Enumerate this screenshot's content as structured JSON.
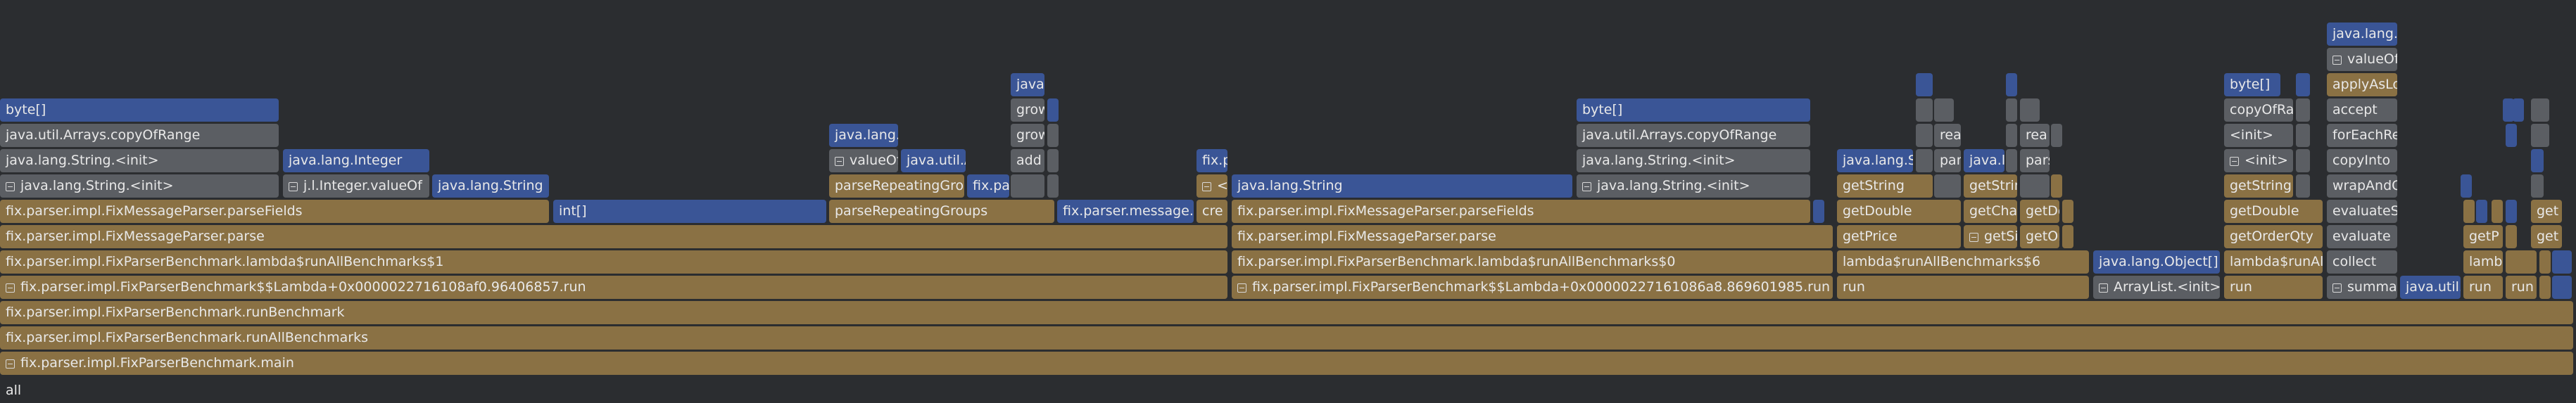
{
  "root_label": "all",
  "frames": {
    "main": "fix.parser.impl.FixParserBenchmark.main",
    "runAll": "fix.parser.impl.FixParserBenchmark.runAllBenchmarks",
    "runBench": "fix.parser.impl.FixParserBenchmark.runBenchmark",
    "lambdaL": "fix.parser.impl.FixParserBenchmark$$Lambda+0x0000022716108af0.96406857.run",
    "lambdaM": "fix.parser.impl.FixParserBenchmark$$Lambda+0x00000227161086a8.869601985.run",
    "run": "run",
    "arrayListInit": "ArrayList.<init>",
    "summar": "summar",
    "javaUtil": "java.util.",
    "runAbbrev": "run",
    "runAbbrev2": "run",
    "lambda1": "fix.parser.impl.FixParserBenchmark.lambda$runAllBenchmarks$1",
    "lambda0": "fix.parser.impl.FixParserBenchmark.lambda$runAllBenchmarks$0",
    "lambda6": "lambda$runAllBenchmarks$6",
    "objArr": "java.lang.Object[]",
    "lambdaRunAll": "lambda$runAll",
    "collect": "collect",
    "lamb": "lamb",
    "parseL": "fix.parser.impl.FixMessageParser.parse",
    "parseM": "fix.parser.impl.FixMessageParser.parse",
    "getPrice": "getPrice",
    "getSi": "getSi",
    "getOr": "getOr",
    "getOrderQty": "getOrderQty",
    "evaluate": "evaluate",
    "getPAbbrev": "getP",
    "getAbbrev": "get",
    "parseFieldsL": "fix.parser.impl.FixMessageParser.parseFields",
    "intArr": "int[]",
    "parseRepeatingGroups": "parseRepeatingGroups",
    "fixParserMessageB": "fix.parser.message.b",
    "cre": "cre",
    "parseFieldsM": "fix.parser.impl.FixMessageParser.parseFields",
    "getDouble": "getDouble",
    "getCha": "getCha",
    "getDo": "getDo",
    "getDouble2": "getDouble",
    "evaluateS": "evaluateS",
    "get2": "get",
    "stringInitL": "java.lang.String.<init>",
    "jlIntegerValueOf": "j.l.Integer.valueOf",
    "javaLangStringL": "java.lang.String",
    "parseRepeatingGrou": "parseRepeatingGrou",
    "fixPa": "fix.pa",
    "init3": "<init",
    "javaLangStringM": "java.lang.String",
    "stringInitM": "java.lang.String.<init>",
    "getString": "getString",
    "getStrin": "getStrin",
    "getString2": "getString",
    "wrapAndC": "wrapAndC",
    "stringInitL2": "java.lang.String.<init>",
    "javaLangInteger": "java.lang.Integer",
    "valueOf": "valueOf",
    "javaUtilA": "java.util.A",
    "add": "add",
    "fixP": "fix.p",
    "stringInitM2": "java.lang.String.<init>",
    "javaLangS": "java.lang.S",
    "par": "par",
    "javaLAbbrev": "java.l",
    "pars": "pars",
    "init4": "<init>",
    "copyInto": "copyInto",
    "copyOfRangeL": "java.util.Arrays.copyOfRange",
    "javaLang": "java.lang.",
    "grow1": "grow",
    "copyOfRangeM": "java.util.Arrays.copyOfRange",
    "rea1": "rea",
    "rea2": "rea",
    "init5": "<init>",
    "forEachRe": "forEachRe",
    "byteArrL": "byte[]",
    "grow2": "grow",
    "byteArrM": "byte[]",
    "copyOfRa": "copyOfRa",
    "accept": "accept",
    "java": "java.",
    "byteArr3": "byte[]",
    "applyAsLo": "applyAsLo",
    "valueOf2": "valueOf",
    "javaLangL": "java.lang.L"
  },
  "colors": {
    "background": "#2b2d30",
    "gray": "#5b5e63",
    "blue": "#3a5596",
    "brown": "#8a7144",
    "text": "#e8e8e8"
  }
}
